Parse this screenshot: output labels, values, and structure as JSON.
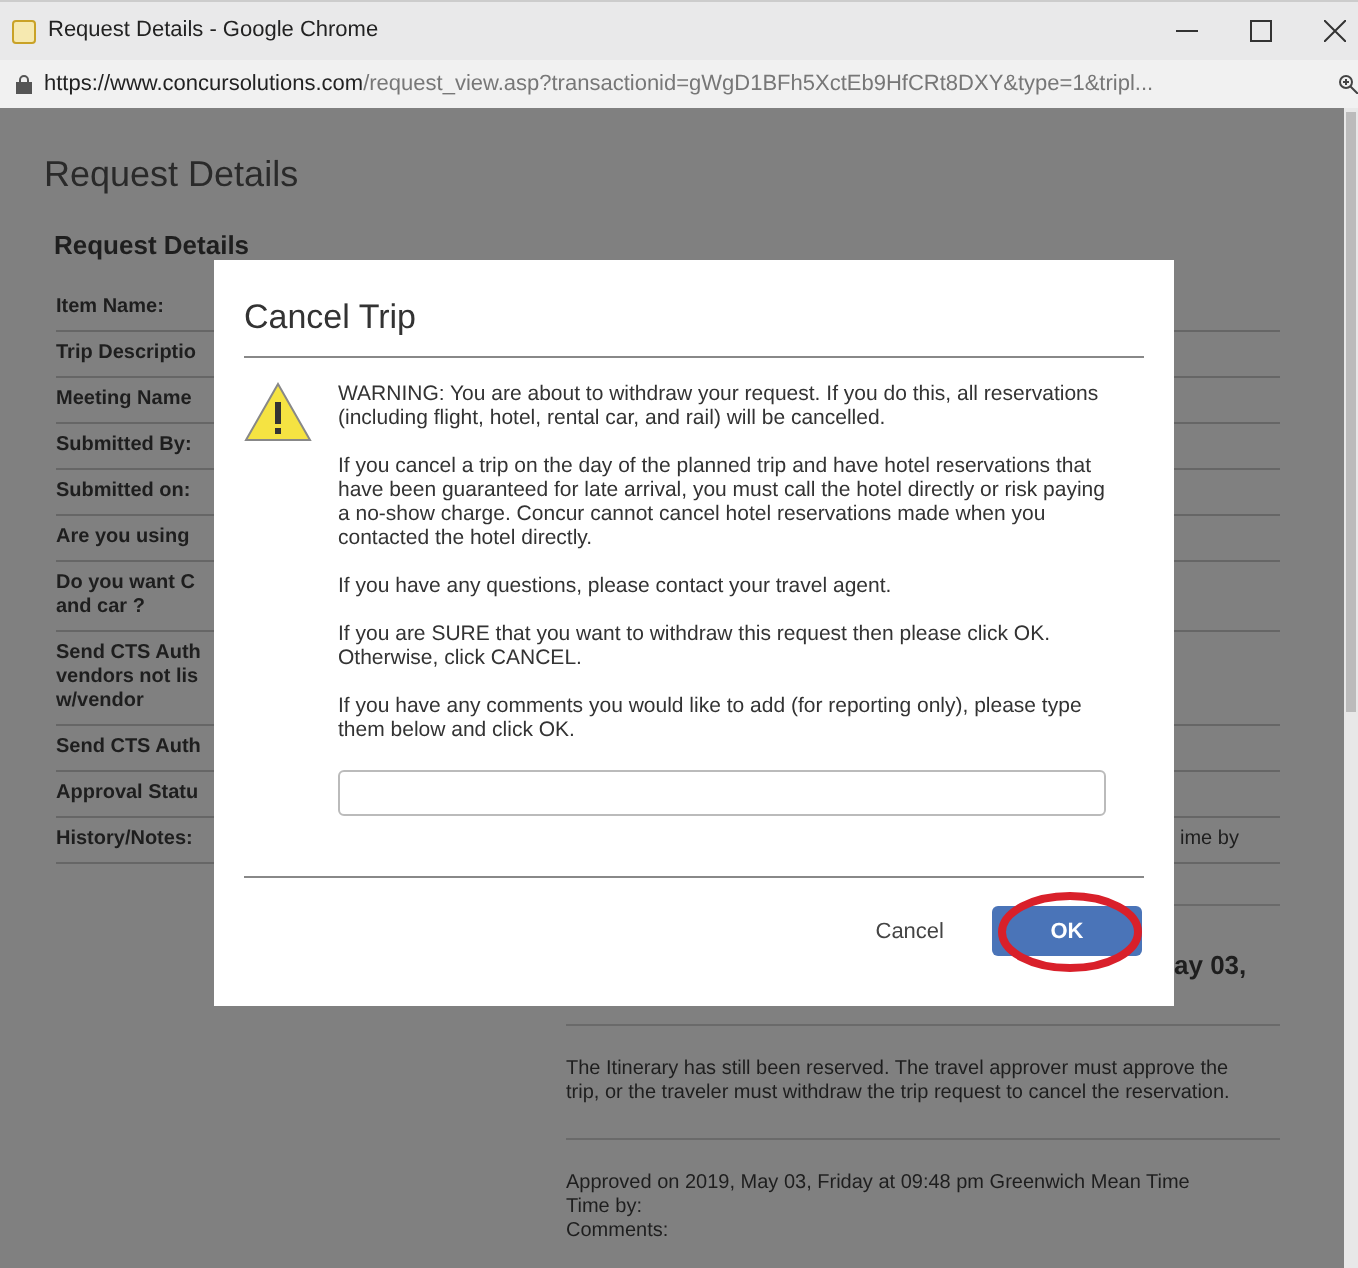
{
  "window": {
    "title": "Request Details - Google Chrome"
  },
  "address_bar": {
    "host": "https://www.concursolutions.com",
    "path": "/request_view.asp?transactionid=gWgD1BFh5XctEb9HfCRt8DXY&type=1&tripl..."
  },
  "page": {
    "title": "Request Details",
    "section_title": "Request Details",
    "fields": [
      {
        "lines": [
          "Item Name:"
        ]
      },
      {
        "lines": [
          "Trip Descriptio"
        ]
      },
      {
        "lines": [
          "Meeting Name"
        ]
      },
      {
        "lines": [
          "Submitted By:"
        ]
      },
      {
        "lines": [
          "Submitted on:"
        ]
      },
      {
        "lines": [
          "Are you using"
        ]
      },
      {
        "lines": [
          "Do you want C",
          "and car ?"
        ]
      },
      {
        "lines": [
          "Send CTS Auth",
          "vendors not lis",
          "w/vendor"
        ]
      },
      {
        "lines": [
          "Send CTS Auth"
        ]
      },
      {
        "lines": [
          "Approval Statu"
        ]
      },
      {
        "lines": [
          "History/Notes:"
        ]
      }
    ],
    "history": [
      {
        "kind": "tail",
        "lines": [
          "ime by"
        ]
      },
      {
        "kind": "heading",
        "lines": [
          "ay 03,"
        ]
      },
      {
        "kind": "text",
        "lines": [
          "The Itinerary has still been reserved. The travel approver must approve the",
          "trip, or the traveler must withdraw the trip request to cancel the reservation."
        ]
      },
      {
        "kind": "text",
        "lines": [
          "Approved on 2019, May 03, Friday at 09:48 pm Greenwich Mean Time",
          "Time by:",
          "Comments:"
        ]
      }
    ]
  },
  "dialog": {
    "title": "Cancel Trip",
    "paragraphs": [
      "WARNING: You are about to withdraw your request. If you do this, all reservations (including flight, hotel, rental car, and rail) will be cancelled.",
      "If you cancel a trip on the day of the planned trip and have hotel reservations that have been guaranteed for late arrival, you must call the hotel directly or risk paying a no-show charge. Concur cannot cancel hotel reservations made when you contacted the hotel directly.",
      "If you have any questions, please contact your travel agent.",
      "If you are SURE that you want to withdraw this request then please click OK. Otherwise, click CANCEL.",
      "If you have any comments you would like to add (for reporting only), please type them below and click OK."
    ],
    "buttons": [
      {
        "label": "Cancel",
        "kind": "plain",
        "highlighted": false
      },
      {
        "label": "OK",
        "kind": "primary",
        "highlighted": true
      }
    ]
  }
}
